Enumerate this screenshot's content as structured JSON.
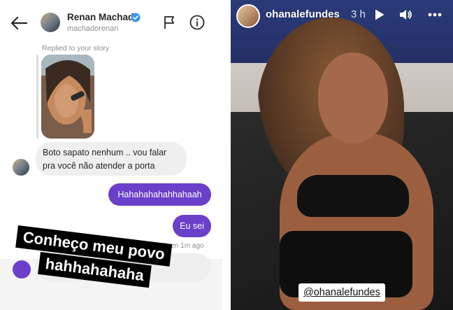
{
  "dm": {
    "header": {
      "name": "Renan Machado",
      "username": "machadorenan"
    },
    "story_reply_label": "Replied to your story",
    "messages": {
      "incoming": "Boto sapato nenhum .. vou falar pra você não atender a porta",
      "outgoing_1": "Hahahahahahhahaah",
      "outgoing_2": "Eu sei"
    },
    "seen": "Seen 1m ago",
    "overlay": {
      "line1": "Conheço meu povo",
      "line2": "hahhahahaha"
    },
    "colors": {
      "outgoing_bubble": "#6a3fc9",
      "verified": "#3897f0"
    }
  },
  "story": {
    "username": "ohanalefundes",
    "time": "3 h",
    "mention": "@ohanalefundes"
  }
}
